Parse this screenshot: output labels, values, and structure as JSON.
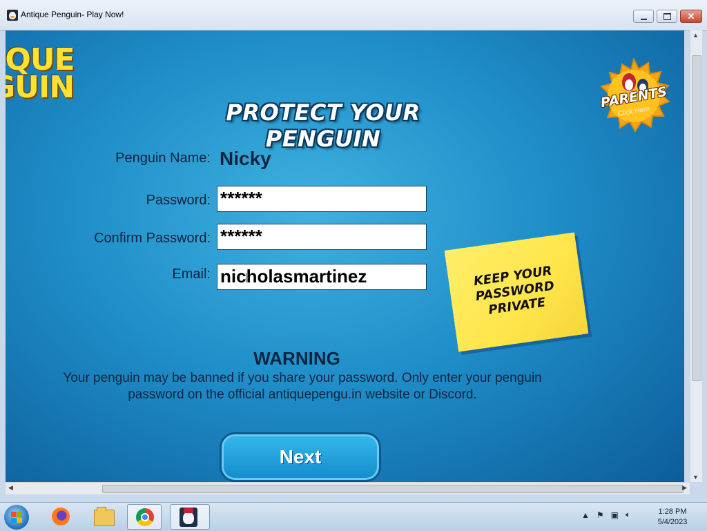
{
  "window": {
    "title": "Antique Penguin- Play Now!",
    "controls": {
      "minimize": "minimize",
      "maximize": "maximize",
      "close": "✕"
    }
  },
  "game": {
    "logo": {
      "line1": "IQUE",
      "line2": "GUIN"
    },
    "heading": "PROTECT YOUR PENGUIN",
    "parents_badge": {
      "title": "PARENTS",
      "subtitle": "Click Here"
    },
    "form": {
      "penguin_name_label": "Penguin Name:",
      "penguin_name_value": "Nicky",
      "password_label": "Password:",
      "password_value": "******",
      "confirm_label": "Confirm Password:",
      "confirm_value": "******",
      "email_label": "Email:",
      "email_value": "nicholasmartinez"
    },
    "sticky_note": "KEEP YOUR PASSWORD PRIVATE",
    "warning_title": "WARNING",
    "warning_body": "Your penguin may be banned if you share your password. Only enter your penguin password on the official  antiquepengu.in website or Discord.",
    "next_button": "Next"
  },
  "taskbar": {
    "items": [
      "Firefox",
      "File Explorer",
      "Google Chrome",
      "Antique Penguin"
    ],
    "clock_time": "1:28 PM",
    "clock_date": "5/4/2023"
  },
  "colors": {
    "game_bg": "#1f8ec9",
    "logo_yellow": "#ffe033",
    "note_yellow": "#ffe54a",
    "text_dark": "#0d2540"
  }
}
